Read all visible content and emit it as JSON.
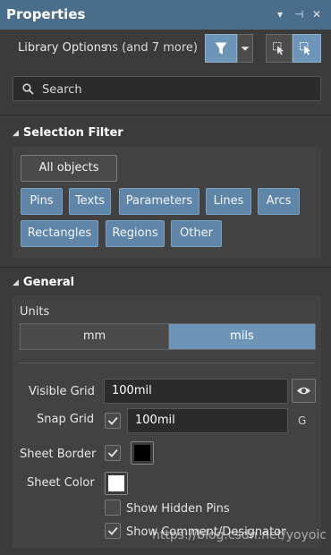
{
  "window": {
    "title": "Properties",
    "controls": [
      "▾",
      "⊣",
      "✕"
    ]
  },
  "toolbar": {
    "library_label": "Library Options",
    "filter_summary": "ns (and 7 more)"
  },
  "search": {
    "placeholder": "Search"
  },
  "selection_filter": {
    "header": "Selection Filter",
    "all_label": "All objects",
    "chips": [
      "Pins",
      "Texts",
      "Parameters",
      "Lines",
      "Arcs",
      "Rectangles",
      "Regions",
      "Other"
    ]
  },
  "general": {
    "header": "General",
    "units_label": "Units",
    "units_options": [
      "mm",
      "mils"
    ],
    "units_selected": "mils",
    "visible_grid_label": "Visible Grid",
    "visible_grid_value": "100mil",
    "snap_grid_label": "Snap Grid",
    "snap_grid_value": "100mil",
    "snap_grid_checked": true,
    "snap_grid_hotkey": "G",
    "sheet_border_label": "Sheet Border",
    "sheet_border_checked": true,
    "sheet_border_color": "#000000",
    "sheet_color_label": "Sheet Color",
    "sheet_color": "#ffffff",
    "show_hidden_pins_label": "Show Hidden Pins",
    "show_hidden_pins_checked": false,
    "show_comment_label": "Show Comment/Designator",
    "show_comment_checked": true
  },
  "watermark": "https://blog.csdn.net/yoyoic",
  "colors": {
    "accent": "#6c95b8",
    "titlebar": "#4a6d8c",
    "background": "#3b3b3b"
  }
}
